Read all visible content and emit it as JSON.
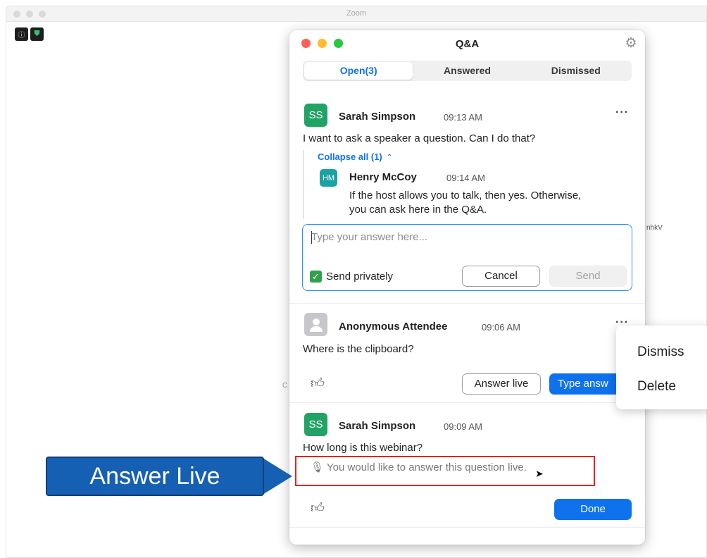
{
  "background_window": {
    "title": "Zoom",
    "fragment_right": "nhkV",
    "fragment_left": "C"
  },
  "qa": {
    "title": "Q&A",
    "tabs": [
      {
        "label": "Open(3)",
        "active": true
      },
      {
        "label": "Answered",
        "active": false
      },
      {
        "label": "Dismissed",
        "active": false
      }
    ],
    "questions": [
      {
        "initials": "SS",
        "name": "Sarah Simpson",
        "time": "09:13 AM",
        "text": "I want to ask a speaker a question. Can I do that?",
        "collapse_label": "Collapse all (1)",
        "reply": {
          "initials": "HM",
          "name": "Henry McCoy",
          "time": "09:14 AM",
          "text_line1": "If the host allows you to talk, then yes. Otherwise,",
          "text_line2": "you can ask here in the Q&A."
        },
        "answer_box": {
          "placeholder": "Type your answer here...",
          "send_privately_label": "Send privately",
          "send_privately_checked": true,
          "cancel_label": "Cancel",
          "send_label": "Send"
        }
      },
      {
        "name": "Anonymous Attendee",
        "time": "09:06 AM",
        "text": "Where is the clipboard?",
        "answer_live_label": "Answer live",
        "type_answer_label": "Type answ"
      },
      {
        "initials": "SS",
        "name": "Sarah Simpson",
        "time": "09:09 AM",
        "text": "How long is this webinar?",
        "live_note": "You would like to answer this question live.",
        "done_label": "Done"
      }
    ]
  },
  "context_menu": {
    "items": [
      "Dismiss",
      "Delete"
    ]
  },
  "annotation": {
    "callout_text": "Answer Live",
    "callout_color": "#1660b4",
    "highlight_color": "#e02424"
  },
  "colors": {
    "accent": "#0e72ed",
    "avatar_green": "#21a365",
    "avatar_teal": "#1ba3a3"
  }
}
